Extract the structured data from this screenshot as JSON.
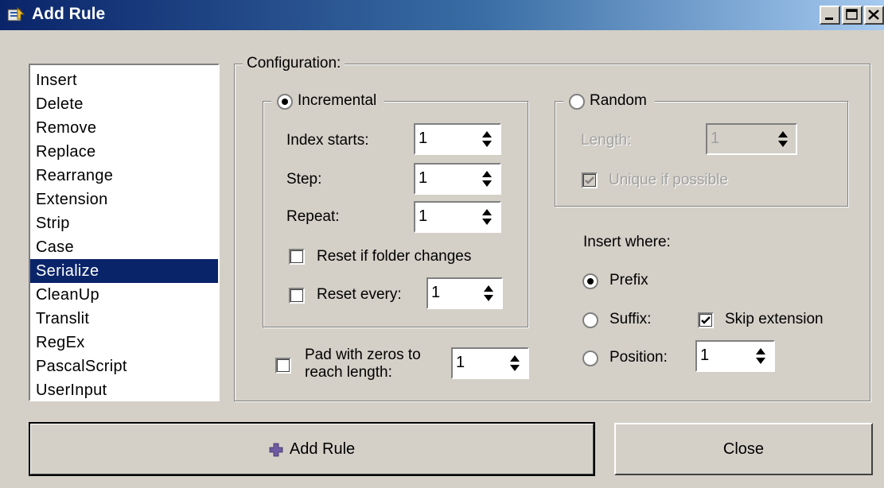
{
  "window": {
    "title": "Add Rule",
    "controls": [
      "minimize-icon",
      "maximize-icon",
      "close-icon"
    ]
  },
  "rule_list": {
    "items": [
      "Insert",
      "Delete",
      "Remove",
      "Replace",
      "Rearrange",
      "Extension",
      "Strip",
      "Case",
      "Serialize",
      "CleanUp",
      "Translit",
      "RegEx",
      "PascalScript",
      "UserInput"
    ],
    "selected": "Serialize"
  },
  "configuration": {
    "label": "Configuration:",
    "incremental": {
      "label": "Incremental",
      "checked": true,
      "index_starts": {
        "label": "Index starts:",
        "value": "1"
      },
      "step": {
        "label": "Step:",
        "value": "1"
      },
      "repeat": {
        "label": "Repeat:",
        "value": "1"
      },
      "reset_folder": {
        "label": "Reset if folder changes",
        "checked": false
      },
      "reset_every": {
        "label": "Reset every:",
        "checked": false,
        "value": "1"
      }
    },
    "random": {
      "label": "Random",
      "checked": false,
      "length": {
        "label": "Length:",
        "value": "1"
      },
      "unique": {
        "label": "Unique if possible",
        "checked": true
      }
    },
    "pad": {
      "label_line1": "Pad with zeros to",
      "label_line2": "reach length:",
      "checked": false,
      "value": "1"
    },
    "insert_where": {
      "label": "Insert where:",
      "prefix": {
        "label": "Prefix",
        "checked": true
      },
      "suffix": {
        "label": "Suffix:",
        "checked": false
      },
      "skip_extension": {
        "label": "Skip extension",
        "checked": true
      },
      "position": {
        "label": "Position:",
        "checked": false,
        "value": "1"
      }
    }
  },
  "buttons": {
    "add_rule": "Add Rule",
    "close": "Close"
  }
}
